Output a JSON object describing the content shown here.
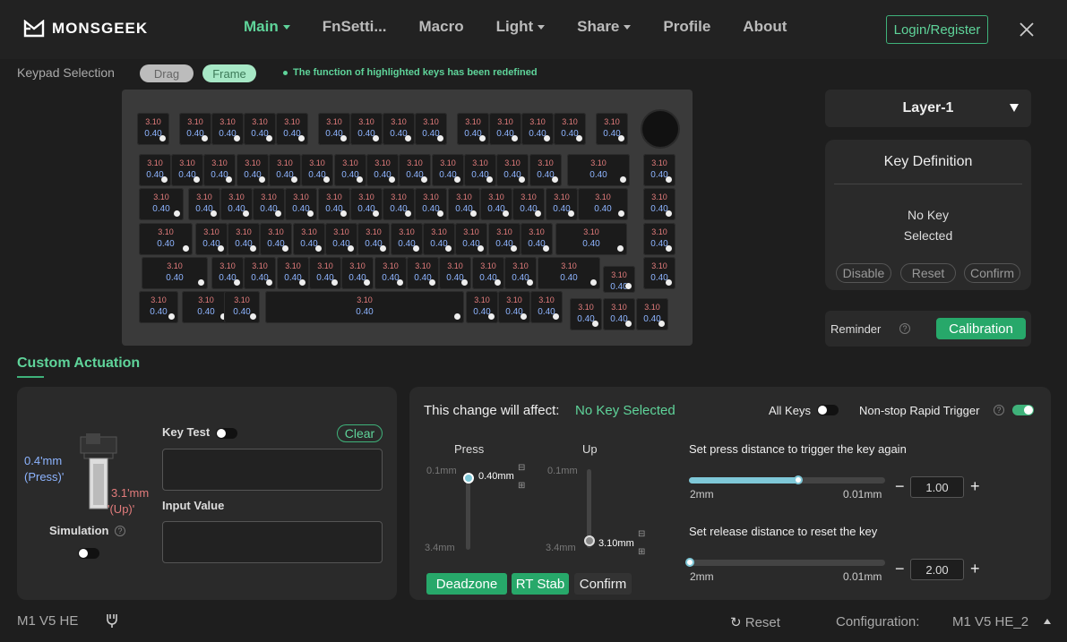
{
  "app": {
    "brand": "MONSGEEK"
  },
  "nav": {
    "items": [
      {
        "label": "Main",
        "caret": true
      },
      {
        "label": "FnSetti...",
        "caret": false
      },
      {
        "label": "Macro",
        "caret": false
      },
      {
        "label": "Light",
        "caret": true
      },
      {
        "label": "Share",
        "caret": true
      },
      {
        "label": "Profile",
        "caret": false
      },
      {
        "label": "About",
        "caret": false
      }
    ],
    "active": "Main"
  },
  "login_label": "Login/Register",
  "keypad": {
    "label": "Keypad Selection",
    "drag": "Drag",
    "frame": "Frame",
    "hint": "The function of highlighted keys has been redefined"
  },
  "keys": {
    "value": "0.40",
    "label": "3.10"
  },
  "layer": {
    "label": "Layer-1"
  },
  "key_definition": {
    "title": "Key Definition",
    "msg1": "No Key",
    "msg2": "Selected",
    "disable": "Disable",
    "reset": "Reset",
    "confirm": "Confirm"
  },
  "reminder": {
    "label": "Reminder",
    "button": "Calibration"
  },
  "custom": {
    "title": "Custom Actuation"
  },
  "left_panel": {
    "press_val": "0.4'mm",
    "press_lbl": "(Press)'",
    "up_val": "3.1'mm",
    "up_lbl": "'(Up)'",
    "simulation": "Simulation",
    "key_test": "Key Test",
    "clear": "Clear",
    "input_value": "Input Value"
  },
  "right_panel": {
    "affect_label": "This change will affect:",
    "affect_value": "No Key Selected",
    "all_keys": "All Keys",
    "nonstop": "Non-stop Rapid Trigger",
    "press": "Press",
    "up": "Up",
    "press_top": "0.1mm",
    "press_bottom": "3.4mm",
    "press_value": "0.40mm",
    "up_top": "0.1mm",
    "up_bottom": "3.4mm",
    "up_value": "3.10mm",
    "deadzone": "Deadzone",
    "rt_stab": "RT Stab",
    "confirm": "Confirm",
    "press_again": "Set press distance to trigger the key again",
    "press_again_min": "2mm",
    "press_again_max": "0.01mm",
    "press_again_value": "1.00",
    "release": "Set release distance to reset the key",
    "release_min": "2mm",
    "release_max": "0.01mm",
    "release_value": "2.00",
    "press_again_level": 0.56,
    "release_level": 0.0,
    "press_level": 0.09,
    "up_level": 0.91
  },
  "footer": {
    "device": "M1 V5 HE",
    "reset": "Reset",
    "config_label": "Configuration:",
    "config_value": "M1 V5 HE_2"
  },
  "colors": {
    "accent": "#5fd49a",
    "button": "#27a86a",
    "key_label": "#e37c7c",
    "key_value": "#8db4ff"
  }
}
